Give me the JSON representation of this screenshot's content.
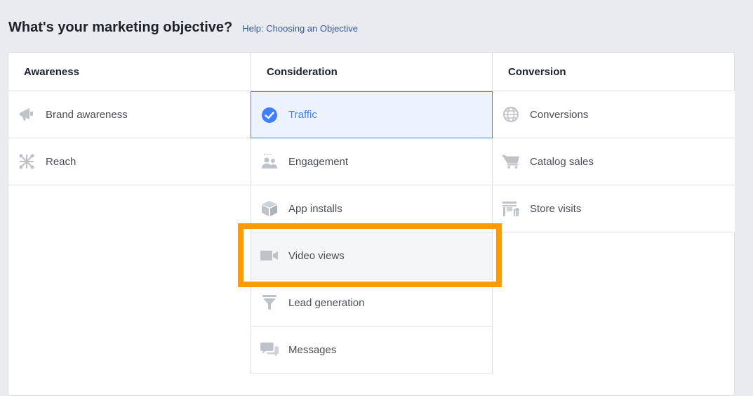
{
  "header": {
    "title": "What's your marketing objective?",
    "help_link": "Help: Choosing an Objective"
  },
  "columns": [
    {
      "title": "Awareness",
      "items": [
        {
          "label": "Brand awareness",
          "icon": "megaphone-icon"
        },
        {
          "label": "Reach",
          "icon": "reach-icon"
        }
      ]
    },
    {
      "title": "Consideration",
      "items": [
        {
          "label": "Traffic",
          "icon": "checkmark-circle-icon",
          "selected": true
        },
        {
          "label": "Engagement",
          "icon": "people-icon"
        },
        {
          "label": "App installs",
          "icon": "box-icon"
        },
        {
          "label": "Video views",
          "icon": "video-camera-icon"
        },
        {
          "label": "Lead generation",
          "icon": "funnel-icon"
        },
        {
          "label": "Messages",
          "icon": "chat-bubbles-icon"
        }
      ]
    },
    {
      "title": "Conversion",
      "items": [
        {
          "label": "Conversions",
          "icon": "globe-icon"
        },
        {
          "label": "Catalog sales",
          "icon": "shopping-cart-icon"
        },
        {
          "label": "Store visits",
          "icon": "store-icon"
        }
      ]
    }
  ],
  "colors": {
    "accent": "#4080ff",
    "highlight": "#ff9a00",
    "icon_gray": "#bec2c9"
  }
}
